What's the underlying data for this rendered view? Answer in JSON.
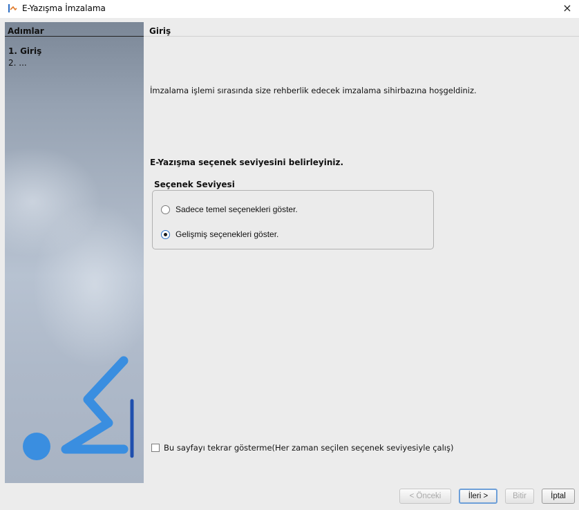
{
  "window": {
    "title": "E-Yazışma İmzalama",
    "close_glyph": "×"
  },
  "steps": {
    "header": "Adımlar",
    "items": [
      {
        "label": "1. Giriş"
      },
      {
        "label": "2. ..."
      }
    ]
  },
  "content": {
    "header": "Giriş",
    "welcome": "İmzalama işlemi sırasında size rehberlik edecek imzalama sihirbazına hoşgeldiniz.",
    "level_prompt": "E-Yazışma seçenek seviyesini  belirleyiniz.",
    "option_group": {
      "label": "Seçenek Seviyesi",
      "options": [
        {
          "label": "Sadece temel seçenekleri göster.",
          "checked": false
        },
        {
          "label": "Gelişmiş seçenekleri göster.",
          "checked": true
        }
      ]
    },
    "dont_show": {
      "label": "Bu sayfayı tekrar gösterme(Her zaman seçilen seçenek seviyesiyle çalış)",
      "checked": false
    }
  },
  "buttons": {
    "prev": "< Önceki",
    "next": "İleri >",
    "finish": "Bitir",
    "cancel": "İptal"
  },
  "colors": {
    "accent_blue": "#3a8ee0",
    "logo_navy": "#1f4fae"
  },
  "icons": {
    "app": "wizard-signature-icon",
    "close": "close-icon",
    "logo": "e-signature-logo"
  }
}
